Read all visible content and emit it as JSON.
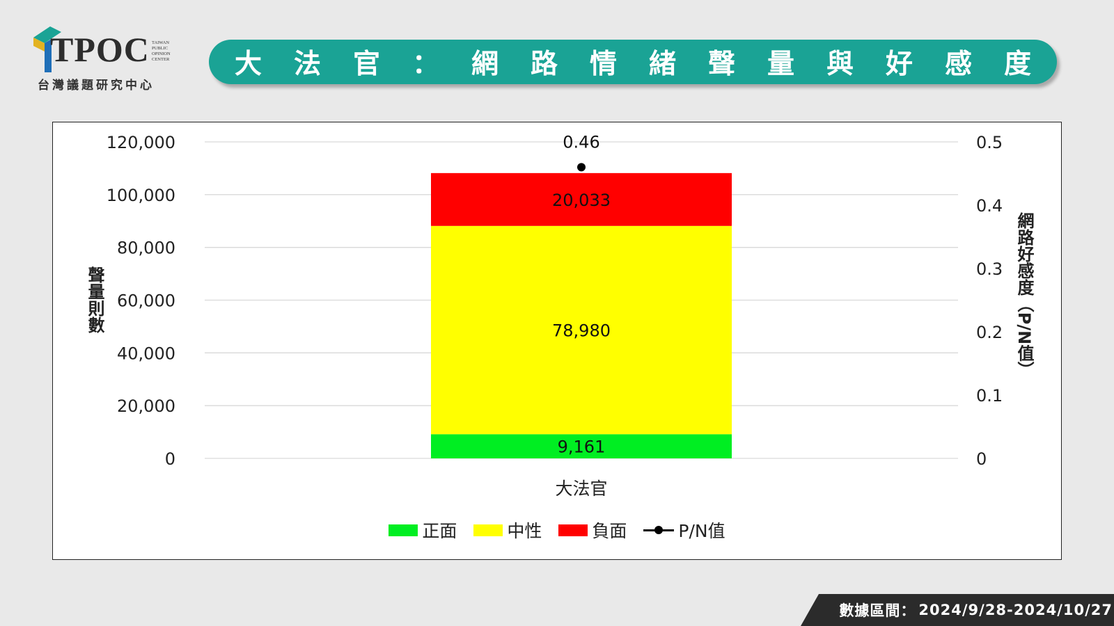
{
  "logo": {
    "text": "TPOC",
    "small_lines": [
      "TAIWAN",
      "PUBLIC",
      "OPINION",
      "CENTER"
    ],
    "subtitle": "台灣議題研究中心"
  },
  "banner": {
    "title": "大法官：網路情緒聲量與好感度"
  },
  "footer": {
    "label": "數據區間：",
    "range": "2024/9/28-2024/10/27"
  },
  "legend": [
    {
      "name": "正面",
      "type": "bar",
      "color": "#00ee22"
    },
    {
      "name": "中性",
      "type": "bar",
      "color": "#ffff00"
    },
    {
      "name": "負面",
      "type": "bar",
      "color": "#ff0000"
    },
    {
      "name": "P/N值",
      "type": "line",
      "color": "#000000"
    }
  ],
  "chart_data": {
    "type": "bar",
    "stacked": true,
    "categories": [
      "大法官"
    ],
    "series": [
      {
        "name": "正面",
        "values": [
          9161
        ],
        "labels": [
          "9,161"
        ],
        "color": "#00ee22"
      },
      {
        "name": "中性",
        "values": [
          78980
        ],
        "labels": [
          "78,980"
        ],
        "color": "#ffff00"
      },
      {
        "name": "負面",
        "values": [
          20033
        ],
        "labels": [
          "20,033"
        ],
        "color": "#ff0000"
      }
    ],
    "line_series": {
      "name": "P/N值",
      "values": [
        0.46
      ],
      "labels": [
        "0.46"
      ],
      "axis": "right",
      "color": "#000000"
    },
    "ylabel": "聲量則數",
    "ylim": [
      0,
      120000
    ],
    "yticks": [
      "0",
      "20,000",
      "40,000",
      "60,000",
      "80,000",
      "100,000",
      "120,000"
    ],
    "ylabel_right": "網路好感度（P/N值）",
    "ylim_right": [
      0,
      0.5
    ],
    "yticks_right": [
      "0",
      "0.1",
      "0.2",
      "0.3",
      "0.4",
      "0.5"
    ],
    "grid": true,
    "legend_position": "bottom"
  }
}
